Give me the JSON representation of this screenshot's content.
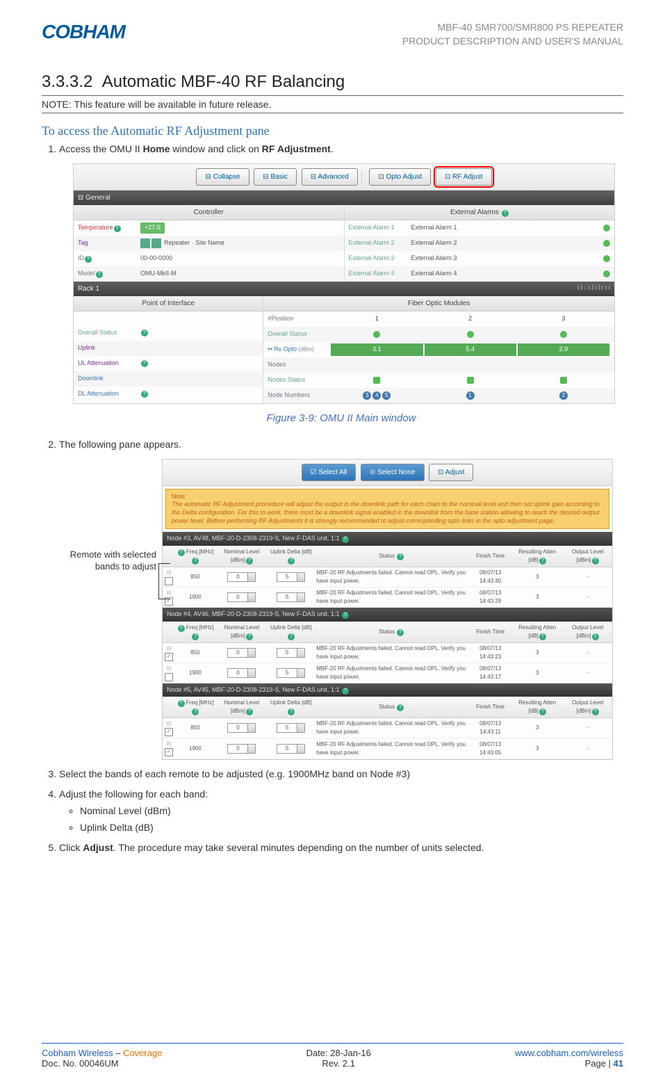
{
  "header": {
    "logo_text": "COBHAM",
    "right_l1": "MBF-40 SMR700/SMR800 PS REPEATER",
    "right_l2": "PRODUCT DESCRIPTION AND USER'S MANUAL"
  },
  "section_number": "3.3.3.2",
  "section_title": "Automatic MBF-40 RF Balancing",
  "note_text": "NOTE: This feature will be available in future release.",
  "blue_heading": "To access the Automatic RF Adjustment pane",
  "step1_prefix": "Access the OMU II ",
  "step1_bold": "Home",
  "step1_mid": " window and click on ",
  "step1_bold2": "RF Adjustment",
  "step1_suffix": ".",
  "fig_caption": "Figure 3-9: OMU II Main window",
  "step2": "The following pane appears.",
  "annot_text": "Remote with selected bands to adjust",
  "step3": "Select the bands of each remote to be adjusted (e.g. 1900MHz band on Node #3)",
  "step4_intro": "Adjust the following for each band:",
  "step4_a": "Nominal Level (dBm)",
  "step4_b": "Uplink Delta (dB)",
  "step5_prefix": "Click ",
  "step5_bold": "Adjust",
  "step5_suffix": ". The procedure may take several minutes depending on the number of units selected.",
  "ss1": {
    "toolbar": [
      "⊟ Collapse",
      "⊟ Basic",
      "⊟ Advanced",
      "⊡ Opto Adjust",
      "⊡ RF Adjust"
    ],
    "general": "⊟ General",
    "controller": "Controller",
    "external_alarms": "External Alarms",
    "rows_left": [
      {
        "label": "Temperature",
        "val": "+27.0",
        "type": "pill"
      },
      {
        "label": "Tag",
        "val": "Repeater · Site Name"
      },
      {
        "label": "ID",
        "val": "00-00-0000"
      },
      {
        "label": "Model",
        "val": "OMU-MkII-M"
      }
    ],
    "rows_right": [
      {
        "label": "External Alarm 1",
        "val": "External Alarm 1"
      },
      {
        "label": "External Alarm 2",
        "val": "External Alarm 2"
      },
      {
        "label": "External Alarm 3",
        "val": "External Alarm 3"
      },
      {
        "label": "External Alarm 4",
        "val": "External Alarm 4"
      }
    ],
    "rack": "Rack 1",
    "poi": "Point of Interface",
    "fiber": "Fiber Optic Modules",
    "poi_rows": [
      "Overall Status",
      "Uplink",
      "UL Attenuation",
      "Downlink",
      "DL Attenuation"
    ],
    "fiber_headers": "#Position",
    "positions": [
      "1",
      "2",
      "3"
    ],
    "overall_status_label": "Overall Status",
    "rx_opto_label": "Rx Opto (dBm)",
    "rx_values": [
      "3.1",
      "5.4",
      "2.9"
    ],
    "nodes_label": "Nodes",
    "nodes_status_label": "Nodes Status",
    "node_numbers_label": "Node Numbers",
    "node_numbers": [
      [
        "3",
        "4",
        "5"
      ],
      [
        "1"
      ],
      [
        "2"
      ]
    ]
  },
  "ss2": {
    "toolbar": [
      "☑ Select All",
      "⊙ Select None",
      "⊡ Adjust"
    ],
    "note_title": "Note:",
    "note_body": "The automatic RF Adjustment procedure will adjust the output in the downlink path for each chain to the nominal level and then set uplink gain according to the Delta configuration. For this to work, there must be a downlink signal enabled in the downlink from the base station allowing to reach the desired output power level. Before performing RF Adjustments it is strongly recommended to adjust corresponding opto links in the opto adjustment page.",
    "tbl_headers": [
      "",
      "Freq [MHz]",
      "Nominal Level [dBm]",
      "Uplink Delta [dB]",
      "Status",
      "Finish Time",
      "Resulting Atten [dB]",
      "Output Level [dBm]"
    ],
    "nodes": [
      {
        "title": "Node #3, AV48, MBF-20-D-2308-2319-S, New F-DAS unit, 1:1",
        "rows": [
          {
            "ck": false,
            "freq": "850",
            "nom": "0",
            "ul": "5",
            "status": "MBF-20 RF Adjustments failed. Cannot read OPL. Verify you have input power.",
            "time": "08/07/13 14:43:40",
            "atten": "3",
            "out": "-"
          },
          {
            "ck": true,
            "freq": "1900",
            "nom": "0",
            "ul": "5",
            "status": "MBF-20 RF Adjustments failed. Cannot read OPL. Verify you have input power.",
            "time": "08/07/13 14:43:29",
            "atten": "3",
            "out": "-"
          }
        ]
      },
      {
        "title": "Node #4, AV46, MBF-20-D-2308-2319-S, New F-DAS unit, 1:1",
        "rows": [
          {
            "ck": true,
            "freq": "850",
            "nom": "0",
            "ul": "5",
            "status": "MBF-20 RF Adjustments failed. Cannot read OPL. Verify you have input power.",
            "time": "08/07/13 14:43:23",
            "atten": "3",
            "out": "-"
          },
          {
            "ck": false,
            "freq": "1900",
            "nom": "0",
            "ul": "5",
            "status": "MBF-20 RF Adjustments failed. Cannot read OPL. Verify you have input power.",
            "time": "08/07/13 14:43:17",
            "atten": "3",
            "out": "-"
          }
        ]
      },
      {
        "title": "Node #5, AV45, MBF-20-D-2308-2319-S, New F-DAS unit, 1:1",
        "rows": [
          {
            "ck": true,
            "freq": "850",
            "nom": "0",
            "ul": "5",
            "status": "MBF-20 RF Adjustments failed. Cannot read OPL. Verify you have input power.",
            "time": "08/07/13 14:43:11",
            "atten": "3",
            "out": "-"
          },
          {
            "ck": true,
            "freq": "1900",
            "nom": "0",
            "ul": "5",
            "status": "MBF-20 RF Adjustments failed. Cannot read OPL. Verify you have input power.",
            "time": "08/07/13 14:43:05",
            "atten": "3",
            "out": "-"
          }
        ]
      }
    ]
  },
  "footer": {
    "l1a": "Cobham Wireless",
    "l1b": " – ",
    "l1c": "Coverage",
    "l2": "Doc. No. 00046UM",
    "c1": "Date: 28-Jan-16",
    "c2": "Rev. 2.1",
    "r1": "www.cobham.com/wireless",
    "r2a": "Page | ",
    "r2b": "41"
  }
}
